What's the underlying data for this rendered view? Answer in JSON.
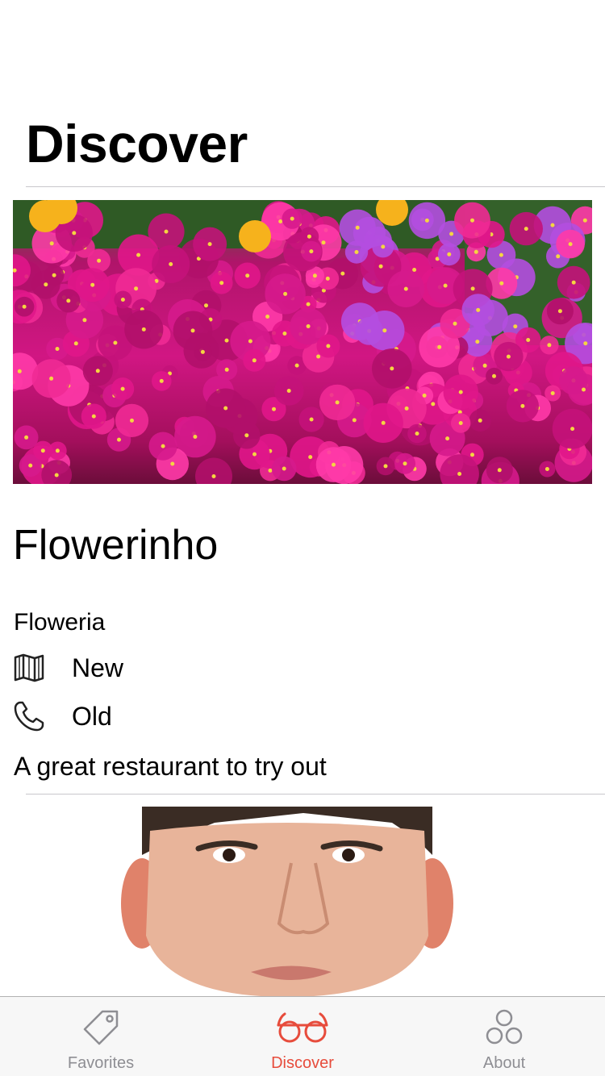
{
  "nav": {
    "title": "Discover"
  },
  "restaurant": {
    "name": "Flowerinho",
    "type": "Floweria",
    "location": "New",
    "phone": "Old",
    "description": "A great restaurant to try out"
  },
  "icons": {
    "location": "map-icon",
    "phone": "phone-icon"
  },
  "tabs": [
    {
      "label": "Favorites",
      "icon": "tag-icon",
      "active": false
    },
    {
      "label": "Discover",
      "icon": "glasses-icon",
      "active": true
    },
    {
      "label": "About",
      "icon": "circles-icon",
      "active": false
    }
  ],
  "colors": {
    "accent": "#e74c3c",
    "tab_inactive": "#8e8e93",
    "separator": "#c8c7cc"
  }
}
